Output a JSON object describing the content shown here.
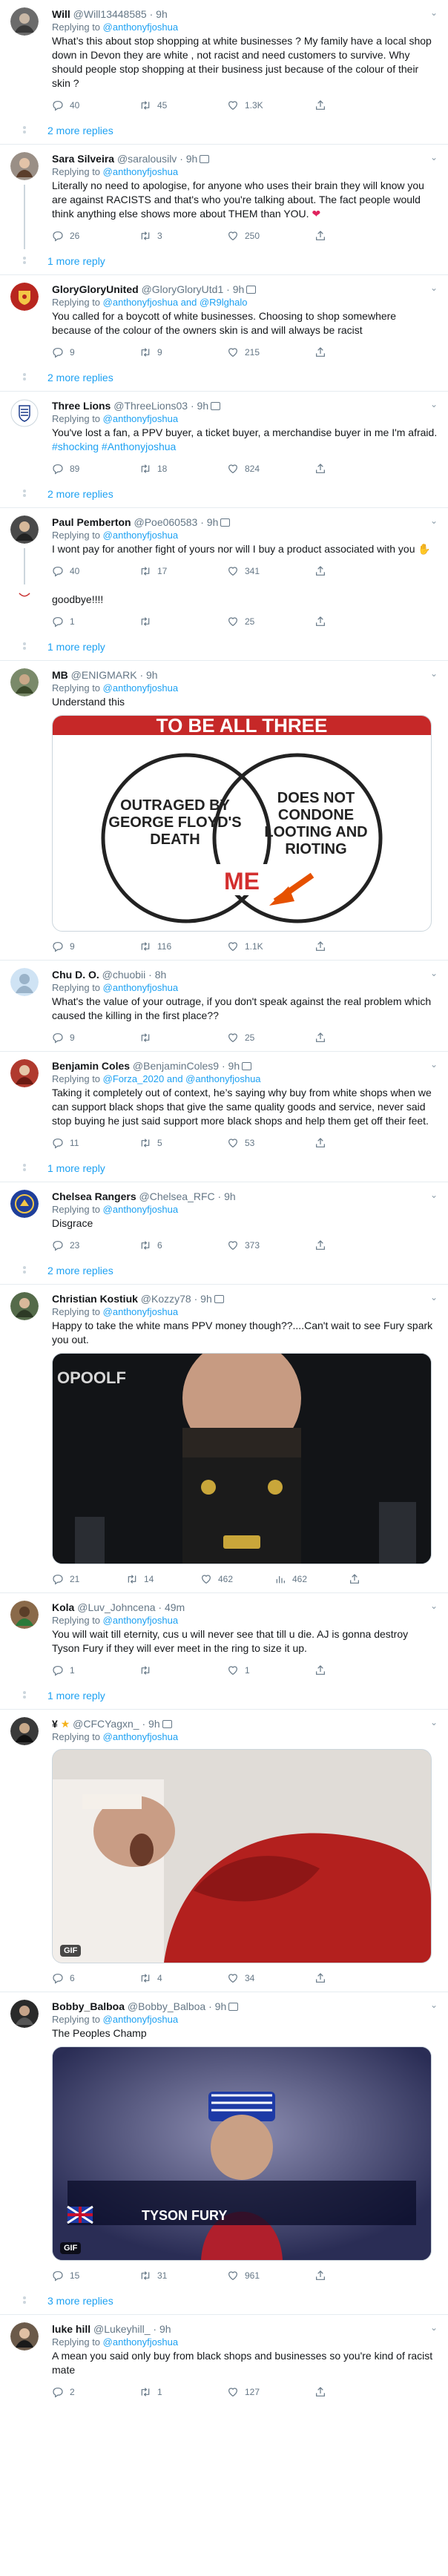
{
  "colors": {
    "accent": "#1da1f2",
    "text": "#14171a",
    "muted": "#657786",
    "border": "#e6ecf0",
    "heart": "#e0245e"
  },
  "tweets": [
    {
      "name": "Will",
      "handle": "@Will13448585",
      "time": "9h",
      "replying_label": "Replying to",
      "reply_to": "@anthonyfjoshua",
      "text": "What’s this about stop shopping at white businesses ? My family have a local shop down in Devon they are white , not racist and need customers to survive. Why should people stop shopping at their business just because of the colour of their skin ?",
      "replies": "40",
      "retweets": "45",
      "likes": "1.3K",
      "more_replies": "2 more replies",
      "avatar_color": "#6b6b6b"
    },
    {
      "name": "Sara Silveira",
      "handle": "@saralousilv",
      "time": "9h",
      "replying_label": "Replying to",
      "reply_to": "@anthonyfjoshua",
      "text": "Literally no need to apologise, for anyone who uses their brain they will know you are against RACISTS and that's who you're talking about. The fact people would think anything else shows more about THEM than YOU.",
      "replies": "26",
      "retweets": "3",
      "likes": "250",
      "more_replies": "1 more reply",
      "avatar_color": "#9a8f86"
    },
    {
      "name": "GloryGloryUnited",
      "handle": "@GloryGloryUtd1",
      "time": "9h",
      "replying_label": "Replying to",
      "reply_to": "@anthonyfjoshua and @R9lghalo",
      "text": "You called for a boycott of white businesses. Choosing to shop somewhere because of the colour of the owners skin is and will always be racist",
      "replies": "9",
      "retweets": "9",
      "likes": "215",
      "more_replies": "2 more replies",
      "avatar_color": "#b8261f"
    },
    {
      "name": "Three Lions",
      "handle": "@ThreeLions03",
      "time": "9h",
      "replying_label": "Replying to",
      "reply_to": "@anthonyfjoshua",
      "text_before": "You've lost a fan, a PPV buyer, a ticket buyer, a merchandise buyer in me I'm afraid. ",
      "text_tags": "#shocking #Anthonyjoshua",
      "replies": "89",
      "retweets": "18",
      "likes": "824",
      "more_replies": "2 more replies",
      "avatar_color": "#ffffff"
    },
    {
      "name": "Paul Pemberton",
      "handle": "@Poe060583",
      "time": "9h",
      "replying_label": "Replying to",
      "reply_to": "@anthonyfjoshua",
      "text": "I wont pay for another fight of yours nor will I buy a product associated with you",
      "replies": "40",
      "retweets": "17",
      "likes": "341",
      "avatar_color": "#4a4a4a"
    },
    {
      "partial_text": "goodbye!!!!",
      "replies": "1",
      "retweets": "",
      "likes": "25",
      "more_replies": "1 more reply"
    },
    {
      "name": "MB",
      "handle": "@ENIGMARK",
      "time": "9h",
      "replying_label": "Replying to",
      "reply_to": "@anthonyfjoshua",
      "text": "Understand this",
      "venn": {
        "top": "TO BE ALL THREE",
        "left": "OUTRAGED BY GEORGE FLOYD'S DEATH",
        "right": "DOES NOT CONDONE LOOTING AND RIOTING",
        "center": "ME"
      },
      "replies": "9",
      "retweets": "116",
      "likes": "1.1K",
      "avatar_color": "#7a8a6a"
    },
    {
      "name": "Chu D. O.",
      "handle": "@chuobii",
      "time": "8h",
      "replying_label": "Replying to",
      "reply_to": "@anthonyfjoshua",
      "text": "What's the value of your outrage, if you don't speak against the real problem which caused the killing in the first place??",
      "replies": "9",
      "retweets": "",
      "likes": "25",
      "avatar_color": "#cfe3f4"
    },
    {
      "name": "Benjamin Coles",
      "handle": "@BenjaminColes9",
      "time": "9h",
      "replying_label": "Replying to",
      "reply_to": "@Forza_2020 and @anthonyfjoshua",
      "text": "Taking it completely out of context, he’s saying why buy from white shops when we can support black shops that give the same quality goods and service, never said stop buying he just said support more black shops and help them get off their feet.",
      "replies": "11",
      "retweets": "5",
      "likes": "53",
      "more_replies": "1 more reply",
      "avatar_color": "#b03a2e"
    },
    {
      "name": "Chelsea Rangers",
      "handle": "@Chelsea_RFC",
      "time": "9h",
      "replying_label": "Replying to",
      "reply_to": "@anthonyfjoshua",
      "text": "Disgrace",
      "replies": "23",
      "retweets": "6",
      "likes": "373",
      "more_replies": "2 more replies",
      "avatar_color": "#1f3f9a"
    },
    {
      "name": "Christian Kostiuk",
      "handle": "@Kozzy78",
      "time": "9h",
      "replying_label": "Replying to",
      "reply_to": "@anthonyfjoshua",
      "text": "Happy to take the white mans PPV money though??....Can't wait to see Fury spark you out.",
      "media_text": "OPOOLF",
      "replies": "21",
      "retweets": "14",
      "likes": "462",
      "views": "462",
      "avatar_color": "#556b4a"
    },
    {
      "name": "Kola",
      "handle": "@Luv_Johncena",
      "time": "49m",
      "replying_label": "Replying to",
      "reply_to": "@anthonyfjoshua",
      "text": "You will wait till eternity, cus u will never see that till u die. AJ is gonna destroy Tyson Fury if they will ever meet in the ring to size it up.",
      "replies": "1",
      "retweets": "",
      "likes": "1",
      "more_replies": "1 more reply",
      "avatar_color": "#8a6a4a"
    },
    {
      "name": "¥",
      "handle": "@CFCYagxn_",
      "time": "9h",
      "replying_label": "Replying to",
      "reply_to": "@anthonyfjoshua",
      "gif": "GIF",
      "replies": "6",
      "retweets": "4",
      "likes": "34",
      "avatar_color": "#3a3a3a"
    },
    {
      "name": "Bobby_Balboa",
      "handle": "@Bobby_Balboa",
      "time": "9h",
      "replying_label": "Replying to",
      "reply_to": "@anthonyfjoshua",
      "text": "The Peoples Champ",
      "gif": "GIF",
      "fighter_label": "TYSON FURY",
      "replies": "15",
      "retweets": "31",
      "likes": "961",
      "more_replies": "3 more replies",
      "avatar_color": "#2a2a2a"
    },
    {
      "name": "luke hill",
      "handle": "@Lukeyhill_",
      "time": "9h",
      "replying_label": "Replying to",
      "reply_to": "@anthonyfjoshua",
      "text": "A mean you said only buy from black shops and businesses so you're kind of racist mate",
      "replies": "2",
      "retweets": "1",
      "likes": "127",
      "avatar_color": "#6b5a4a"
    }
  ]
}
